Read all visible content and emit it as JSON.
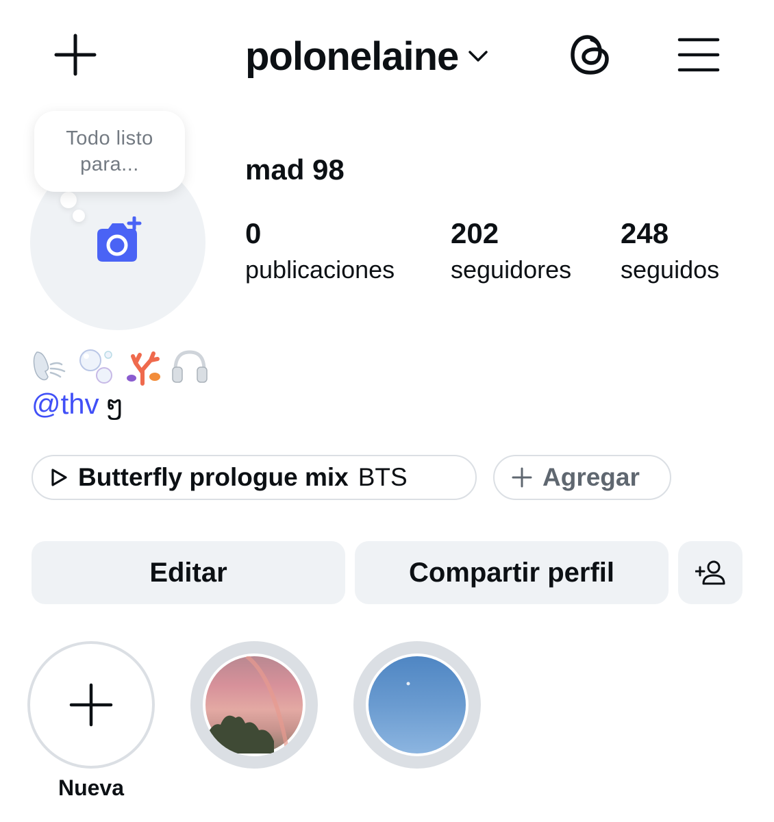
{
  "header": {
    "username": "polonelaine"
  },
  "profile": {
    "note": "Todo listo para...",
    "display_name": "mad 98",
    "stats": [
      {
        "value": "0",
        "label": "publicaciones"
      },
      {
        "value": "202",
        "label": "seguidores"
      },
      {
        "value": "248",
        "label": "seguidos"
      }
    ],
    "bio": {
      "emoji_names": [
        "face-blowing-wind-icon",
        "bubbles-icon",
        "coral-icon",
        "headphones-icon"
      ],
      "mention": "@thv",
      "mention_suffix": "ໆ"
    }
  },
  "music": {
    "title": "Butterfly prologue mix",
    "artist": "BTS"
  },
  "add_button": {
    "label": "Agregar"
  },
  "actions": {
    "edit_label": "Editar",
    "share_label": "Compartir perfil"
  },
  "highlights": {
    "new_label": "Nueva"
  },
  "colors": {
    "accent_blue": "#4150f7",
    "camera_icon": "#4a63f5",
    "button_bg": "#eff2f5",
    "border": "#dbdfe4"
  }
}
